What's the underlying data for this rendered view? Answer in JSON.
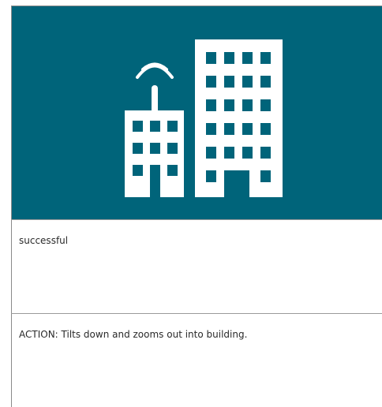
{
  "hero": {
    "icon": "buildings-with-antenna-icon",
    "background_color": "#00647a",
    "icon_color": "#ffffff"
  },
  "status": {
    "text": "successful"
  },
  "action": {
    "text": "ACTION: Tilts down and zooms out into building."
  }
}
